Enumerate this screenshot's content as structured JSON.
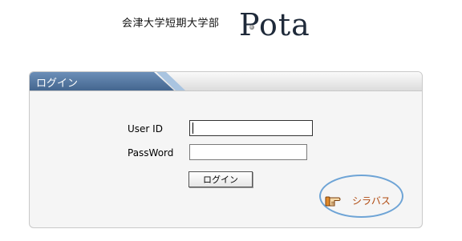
{
  "header": {
    "university": "会津大学短期大学部",
    "logo": "Pota"
  },
  "login": {
    "title": "ログイン",
    "user_label": "User ID",
    "pass_label": "PassWord",
    "user_value": "",
    "pass_value": "",
    "button_label": "ログイン"
  },
  "syllabus": {
    "label": "シラバス",
    "icon": "pointing-hand-icon"
  },
  "colors": {
    "tab": "#4f73a0",
    "ring": "#6ea4d6",
    "link": "#b04a10"
  }
}
